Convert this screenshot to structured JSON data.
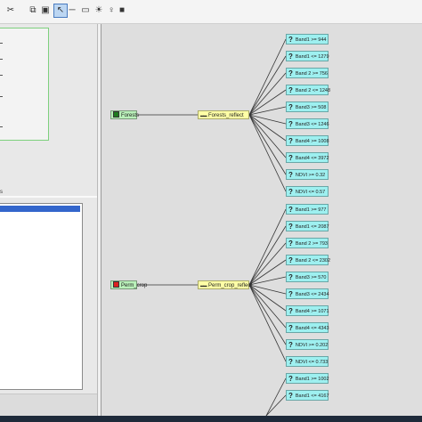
{
  "toolbar": {
    "buttons": [
      {
        "name": "scissors-icon",
        "glyph": "✂"
      },
      {
        "name": "copy-icon",
        "glyph": "⧉"
      },
      {
        "name": "paste-icon",
        "glyph": "▣"
      },
      {
        "name": "select-arrow-icon",
        "glyph": "↖"
      },
      {
        "name": "line-tool-icon",
        "glyph": "─"
      },
      {
        "name": "connector-tool-icon",
        "glyph": "▭"
      },
      {
        "name": "lightbulb-icon",
        "glyph": "☀"
      },
      {
        "name": "bulb-on-icon",
        "glyph": "♀"
      },
      {
        "name": "pin-icon",
        "glyph": "■"
      }
    ]
  },
  "left_panel": {
    "list_label_stub": "s"
  },
  "tree": {
    "groups": [
      {
        "class_label": "Forests",
        "class_color": "#1f7a1f",
        "rule_label": "Forests_reflect",
        "conditions": [
          "Band1 >= 944",
          "Band1 <= 1279",
          "Band 2 >= 756",
          "Band 2 <= 1248",
          "Band3 >= 508",
          "Band3 <= 1246",
          "Band4 >= 1008",
          "Band4 <= 3972",
          "NDVI >= 0.32",
          "NDVI <= 0.57"
        ]
      },
      {
        "class_label": "Perm_crop",
        "class_color": "#dd2020",
        "rule_label": "Perm_crop_reflect",
        "conditions": [
          "Band1 >= 977",
          "Band1 <= 2087",
          "Band 2 >= 793",
          "Band 2 <= 2302",
          "Band3 >= 570",
          "Band3 <= 2434",
          "Band4 >= 1071",
          "Band4 <= 4343",
          "NDVI >= 0.202",
          "NDVI <= 0.733"
        ]
      },
      {
        "class_label": "",
        "class_color": "",
        "rule_label": "",
        "conditions": [
          "Band1 >= 1002",
          "Band1 <= 4167"
        ]
      }
    ]
  },
  "colors": {
    "class_fill": "#b9f0b9",
    "rule_fill": "#ffffa6",
    "cond_fill": "#9ef0f0",
    "canvas_bg": "#dedede"
  }
}
